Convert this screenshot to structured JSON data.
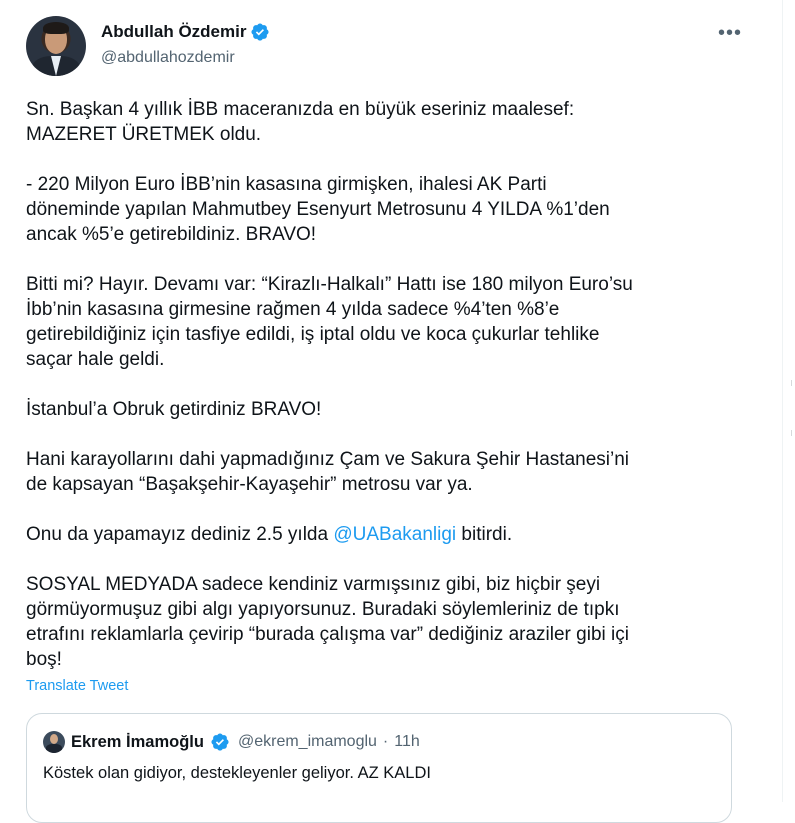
{
  "author": {
    "display_name": "Abdullah Özdemir",
    "handle": "@abdullahozdemir",
    "avatar_icon": "profile-photo",
    "verified_icon": "verified-badge-icon"
  },
  "more_label": "•••",
  "tweet": {
    "paragraphs": [
      "Sn. Başkan 4 yıllık İBB maceranızda en büyük eseriniz maalesef:\nMAZERET ÜRETMEK oldu.",
      "- 220 Milyon Euro İBB’nin kasasına girmişken, ihalesi AK Parti\ndöneminde yapılan Mahmutbey Esenyurt Metrosunu 4 YILDA %1’den\nancak %5’e getirebildiniz. BRAVO!",
      "Bitti mi? Hayır. Devamı var: “Kirazlı-Halkalı” Hattı ise 180 milyon Euro’su\nİbb’nin kasasına girmesine rağmen 4 yılda sadece %4’ten %8’e\ngetirebildiğiniz için tasfiye edildi, iş iptal oldu ve koca çukurlar tehlike\nsaçar hale geldi.",
      "İstanbul’a Obruk getirdiniz BRAVO!",
      "Hani karayollarını dahi yapmadığınız Çam ve Sakura Şehir Hastanesi’ni\nde kapsayan “Başakşehir-Kayaşehir” metrosu var ya.",
      "SOSYAL MEDYADA sadece kendiniz varmışsınız gibi, biz hiçbir şeyi\ngörmüyormuşuz gibi algı yapıyorsunuz. Buradaki söylemleriniz de tıpkı\netrafını reklamlarla çevirip “burada çalışma var” dediğiniz araziler gibi içi\nboş!"
    ],
    "mention_line": {
      "before": "Onu da yapamayız dediniz 2.5 yılda ",
      "mention": "@UABakanligi",
      "after": " bitirdi."
    }
  },
  "translate_label": "Translate Tweet",
  "quoted": {
    "display_name": "Ekrem İmamoğlu",
    "handle": "@ekrem_imamoglu",
    "separator": "·",
    "time": "11h",
    "text": "Köstek olan gidiyor, destekleyenler geliyor. AZ KALDI"
  },
  "colors": {
    "text": "#0f1419",
    "secondary": "#536471",
    "link": "#1d9bf0",
    "border": "#cfd9de"
  }
}
